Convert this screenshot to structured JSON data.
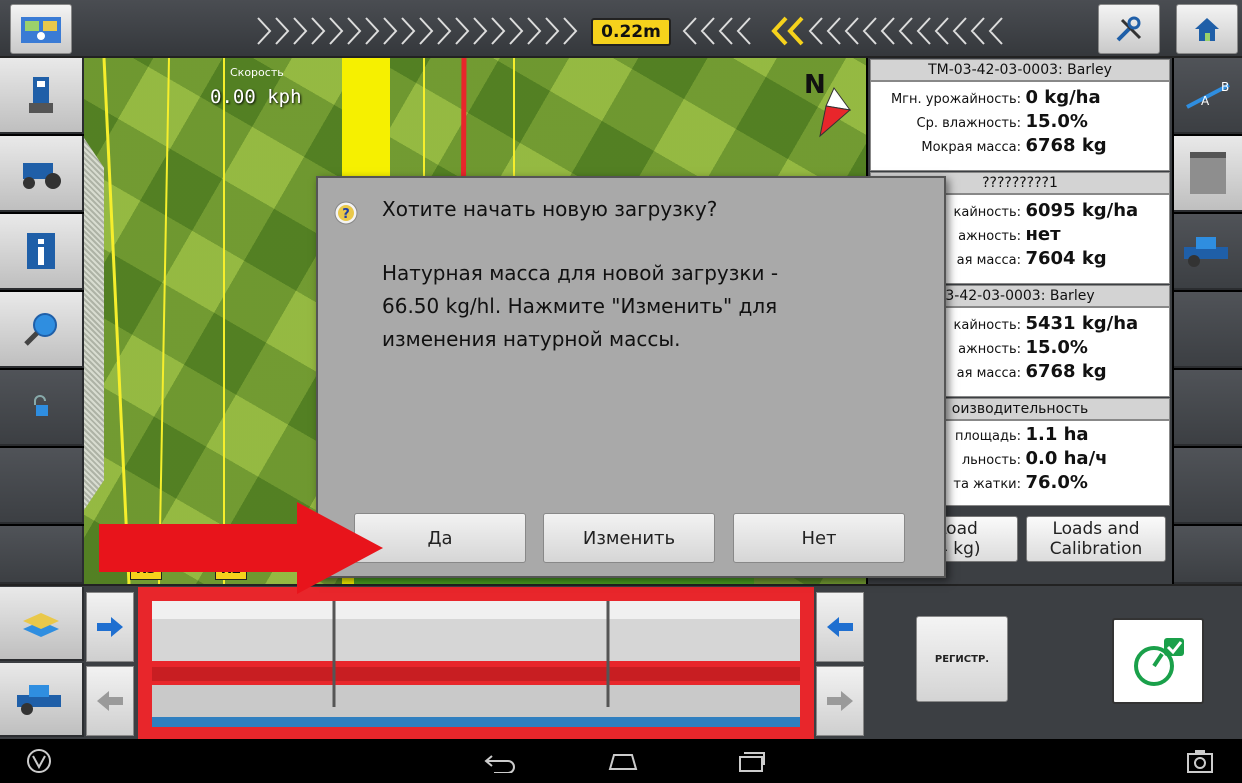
{
  "top_bar": {
    "offset": "0.22m",
    "icons": [
      "satellite-icon",
      "tools-icon",
      "home-icon"
    ]
  },
  "map": {
    "speed_label": "Скорость",
    "speed_value": "0.00 kph",
    "compass_letter": "N",
    "row_labels": [
      "R3",
      "R2",
      "R1"
    ]
  },
  "info_panel": {
    "field1": {
      "header": "TM-03-42-03-0003: Barley",
      "rows": [
        {
          "label": "Мгн. урожайность:",
          "value": "0 kg/ha"
        },
        {
          "label": "Ср. влажность:",
          "value": "15.0%"
        },
        {
          "label": "Мокрая масса:",
          "value": "6768 kg"
        }
      ]
    },
    "field2": {
      "header": "?????????1",
      "rows": [
        {
          "label": "кайность:",
          "value": "6095 kg/ha"
        },
        {
          "label": "ажность:",
          "value": "нет"
        },
        {
          "label": "ая масса:",
          "value": "7604 kg"
        }
      ]
    },
    "field3": {
      "header": "3-42-03-0003: Barley",
      "rows": [
        {
          "label": "кайность:",
          "value": "5431 kg/ha"
        },
        {
          "label": "ажность:",
          "value": "15.0%"
        },
        {
          "label": "ая масса:",
          "value": "6768 kg"
        }
      ]
    },
    "productivity": {
      "header": "оизводительность",
      "rows": [
        {
          "label": "площадь:",
          "value": "1.1 ha"
        },
        {
          "label": "льность:",
          "value": "0.0 ha/ч"
        },
        {
          "label": "та жатки:",
          "value": "76.0%"
        }
      ]
    },
    "buttons": {
      "load_line1": "Load",
      "load_line2": "4 kg)",
      "loads_calib_line1": "Loads and",
      "loads_calib_line2": "Calibration"
    }
  },
  "dialog": {
    "title": "Хотите начать новую загрузку?",
    "body_line1": "Натурная масса для новой загрузки -",
    "body_line2": "66.50 kg/hl. Нажмите \"Изменить\" для",
    "body_line3": "изменения натурной массы.",
    "btn_yes": "Да",
    "btn_change": "Изменить",
    "btn_no": "Нет"
  },
  "bottom": {
    "register_label": "РЕГИСТР."
  },
  "colors": {
    "accent_yellow": "#f6d21c",
    "header_red": "#e8262b",
    "header_blue": "#2f7fc0",
    "panel_dark": "#3c3f43"
  }
}
